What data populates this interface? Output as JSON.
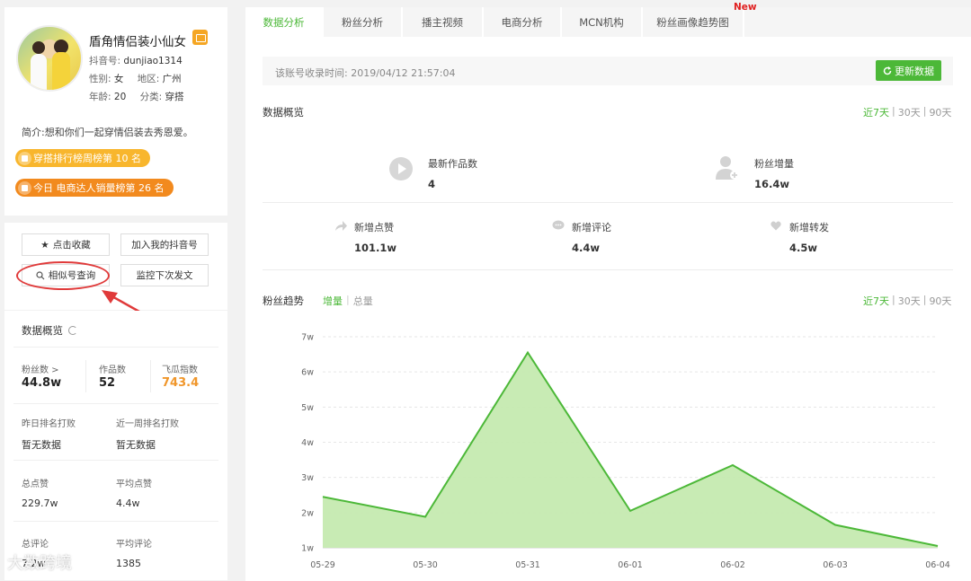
{
  "profile": {
    "nickname": "盾角情侣装小仙女",
    "douyin_id_label": "抖音号:",
    "douyin_id": "dunjiao1314",
    "gender_label": "性别:",
    "gender": "女",
    "region_label": "地区:",
    "region": "广州",
    "age_label": "年龄:",
    "age": "20",
    "category_label": "分类:",
    "category": "穿搭",
    "bio": "简介:想和你们一起穿情侣装去秀恩爱。",
    "rank_badge_1": "穿搭排行榜周榜第 10 名",
    "rank_badge_2": "今日 电商达人销量榜第 26 名"
  },
  "actions": {
    "favorite": "点击收藏",
    "add_to_mine": "加入我的抖音号",
    "similar": "相似号查询",
    "monitor": "监控下次发文"
  },
  "stats": {
    "title": "数据概览",
    "fans_label": "粉丝数 >",
    "fans": "44.8w",
    "works_label": "作品数",
    "works": "52",
    "feigua_label": "飞瓜指数",
    "feigua": "743.4",
    "yday_rank_label": "昨日排名打败",
    "yday_rank": "暂无数据",
    "week_rank_label": "近一周排名打败",
    "week_rank": "暂无数据",
    "total_likes_label": "总点赞",
    "total_likes": "229.7w",
    "avg_likes_label": "平均点赞",
    "avg_likes": "4.4w",
    "total_comments_label": "总评论",
    "total_comments": "7.2w",
    "avg_comments_label": "平均评论",
    "avg_comments": "1385"
  },
  "tabs": [
    "数据分析",
    "粉丝分析",
    "播主视频",
    "电商分析",
    "MCN机构",
    "粉丝画像趋势图"
  ],
  "new_badge": "New",
  "record_time": "该账号收录时间: 2019/04/12 21:57:04",
  "update_button": "更新数据",
  "overview": {
    "title": "数据概览",
    "range_7": "近7天",
    "range_30": "30天",
    "range_90": "90天",
    "new_works_label": "最新作品数",
    "new_works": "4",
    "fans_growth_label": "粉丝增量",
    "fans_growth": "16.4w",
    "new_likes_label": "新增点赞",
    "new_likes": "101.1w",
    "new_comments_label": "新增评论",
    "new_comments": "4.4w",
    "new_shares_label": "新增转发",
    "new_shares": "4.5w"
  },
  "trend": {
    "title": "粉丝趋势",
    "toggle_increment": "增量",
    "toggle_total": "总量",
    "range_7": "近7天",
    "range_30": "30天",
    "range_90": "90天"
  },
  "watermark": "大数跨境",
  "colors": {
    "accent": "#4cb838",
    "area_fill": "#c5eab0",
    "badge_yellow": "#f8b62d",
    "badge_orange": "#f28a1e",
    "feigua_orange": "#f0962a",
    "annotation_red": "#e03a3a"
  },
  "chart_data": {
    "type": "area",
    "categories": [
      "05-29",
      "05-30",
      "05-31",
      "06-01",
      "06-02",
      "06-03",
      "06-04"
    ],
    "values": [
      2.45,
      1.88,
      6.55,
      2.05,
      3.35,
      1.65,
      1.05
    ],
    "ylim": [
      1,
      7
    ],
    "yticks": [
      "1w",
      "2w",
      "3w",
      "4w",
      "5w",
      "6w",
      "7w"
    ],
    "grid": true
  }
}
